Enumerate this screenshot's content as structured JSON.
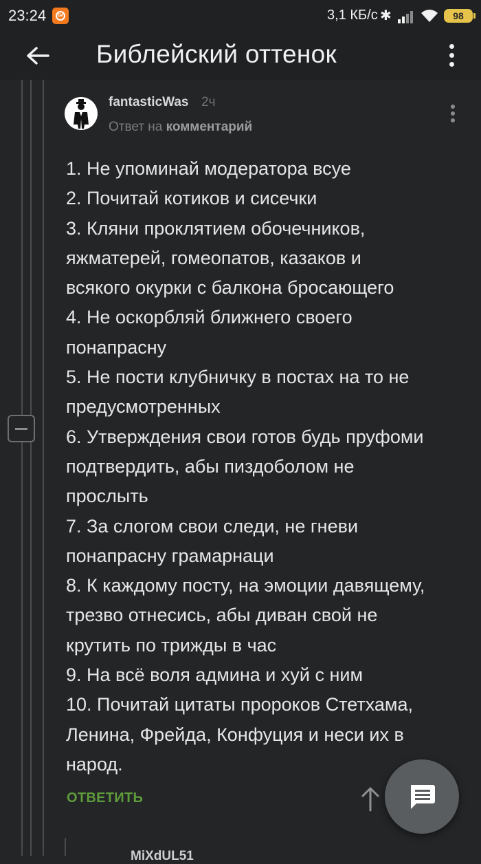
{
  "status_bar": {
    "time": "23:24",
    "network_speed": "3,1 КБ/с",
    "battery_level": "98",
    "battery_color": "#e6c34a"
  },
  "app_bar": {
    "title": "Библейский оттенок",
    "back_icon": "arrow-left-icon",
    "menu_icon": "more-vertical-icon"
  },
  "comment": {
    "author": "fantasticWas",
    "time_ago": "2ч",
    "reply_prefix": "Ответ на",
    "reply_target": "комментарий",
    "lines": [
      "1. Не упоминай модератора всуе",
      "2. Почитай котиков и сисечки",
      "3. Кляни проклятием обочечников,",
      "яжматерей, гомеопатов, казаков и",
      "всякого окурки с балкона бросающего",
      "4. Не оскорбляй ближнего своего",
      "понапрасну",
      "5. Не пости клубничку в постах на то не",
      "предусмотренных",
      "6. Утверждения свои готов будь пруфоми",
      "подтвердить, абы пиздоболом не",
      "прослыть",
      "7. За слогом свои следи, не гневи",
      "понапрасну грамарнаци",
      "8. К каждому посту, на эмоции давящему,",
      "трезво отнесись, абы диван свой не",
      "крутить по трижды в час",
      "9. На всё воля админа и хуй с ним",
      "10. Почитай цитаты пророков Стетхама,",
      "Ленина, Фрейда, Конфуция и неси их в",
      "народ."
    ],
    "reply_label": "ОТВЕТИТЬ",
    "reply_color": "#5e9b3a"
  },
  "next_comment": {
    "author_partial": "MiXdUL51"
  },
  "fab": {
    "icon": "message-icon"
  }
}
